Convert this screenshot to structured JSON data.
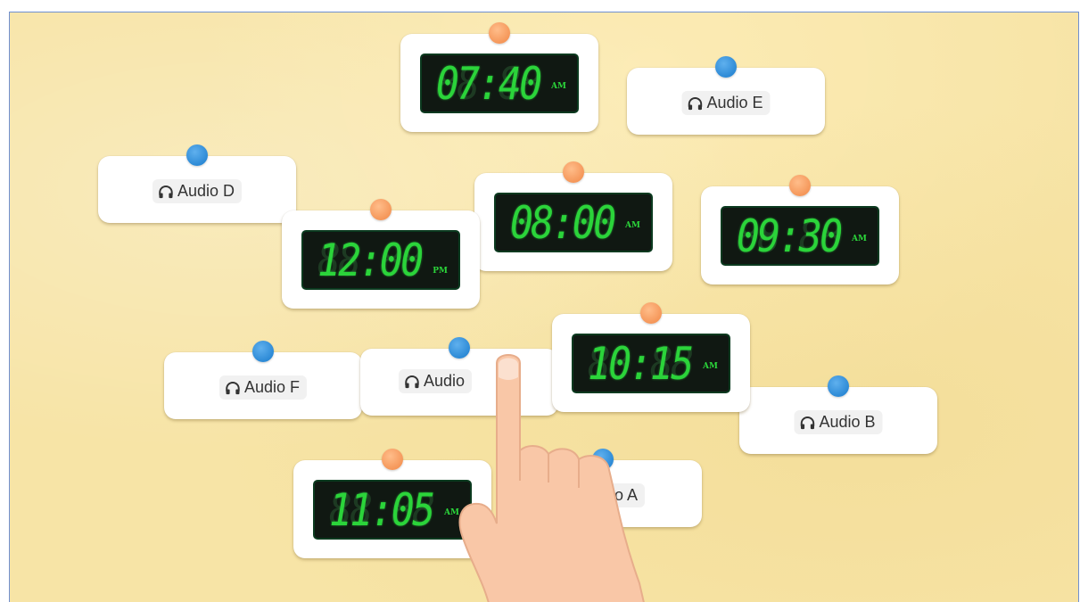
{
  "clocks": [
    {
      "time": "07:40",
      "meridiem": "AM"
    },
    {
      "time": "12:00",
      "meridiem": "PM"
    },
    {
      "time": "08:00",
      "meridiem": "AM"
    },
    {
      "time": "09:30",
      "meridiem": "AM"
    },
    {
      "time": "10:15",
      "meridiem": "AM"
    },
    {
      "time": "11:05",
      "meridiem": "AM"
    }
  ],
  "audio": [
    {
      "label": "Audio E"
    },
    {
      "label": "Audio D"
    },
    {
      "label": "Audio F"
    },
    {
      "label": "Audio"
    },
    {
      "label": "Audio B"
    },
    {
      "label": "o A"
    }
  ],
  "ghost_digits": "88:88",
  "icons": {
    "audio": "headphones-icon",
    "pointer": "hand-pointer"
  },
  "colors": {
    "background": "#f7e4a6",
    "clock_pin": "#f5975a",
    "audio_pin": "#2d8ad6",
    "lcd_on": "#2bd43a",
    "lcd_bg": "#101812"
  }
}
